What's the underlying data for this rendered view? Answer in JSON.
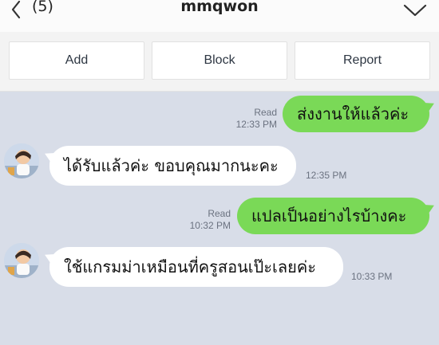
{
  "header": {
    "back_icon": "chevron-left-icon",
    "unread_count": "(5)",
    "title": "mmqwon",
    "menu_icon": "chevron-down-icon"
  },
  "actions": {
    "add_label": "Add",
    "block_label": "Block",
    "report_label": "Report"
  },
  "messages": [
    {
      "direction": "out",
      "text": "ส่งงานให้แล้วค่ะ",
      "status": "Read",
      "time": "12:33 PM"
    },
    {
      "direction": "in",
      "text": "ได้รับแล้วค่ะ ขอบคุณมากนะคะ",
      "time": "12:35 PM"
    },
    {
      "direction": "out",
      "text": "แปลเป็นอย่างไรบ้างคะ",
      "status": "Read",
      "time": "10:32 PM"
    },
    {
      "direction": "in",
      "text": "ใช้แกรมม่าเหมือนที่ครูสอนเป๊ะเลยค่ะ",
      "time": "10:33 PM"
    }
  ],
  "colors": {
    "outgoing_bubble": "#7ad957",
    "incoming_bubble": "#ffffff",
    "chat_background": "#d8dde8"
  }
}
